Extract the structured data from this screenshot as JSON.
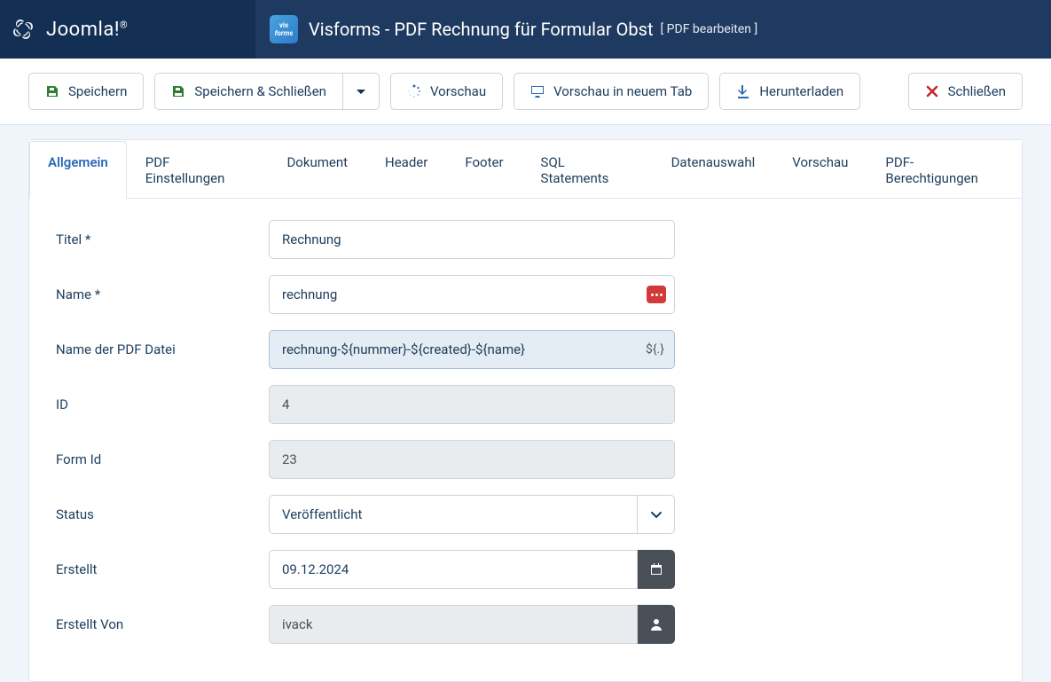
{
  "brand": "Joomla!",
  "appIconTop": "vis",
  "appIconBottom": "forms",
  "pageTitle": "Visforms - PDF Rechnung für Formular Obst",
  "pageSub": "[ PDF bearbeiten ]",
  "toolbar": {
    "save": "Speichern",
    "saveClose": "Speichern & Schließen",
    "preview": "Vorschau",
    "previewNewTab": "Vorschau in neuem Tab",
    "download": "Herunterladen",
    "close": "Schließen"
  },
  "tabs": [
    "Allgemein",
    "PDF Einstellungen",
    "Dokument",
    "Header",
    "Footer",
    "SQL Statements",
    "Datenauswahl",
    "Vorschau",
    "PDF-Berechtigungen"
  ],
  "form": {
    "titel_label": "Titel *",
    "titel_value": "Rechnung",
    "name_label": "Name *",
    "name_value": "rechnung",
    "pdfname_label": "Name der PDF Datei",
    "pdfname_value": "rechnung-${nummer}-${created}-${name}",
    "pdfname_hint": "${.}",
    "id_label": "ID",
    "id_value": "4",
    "formid_label": "Form Id",
    "formid_value": "23",
    "status_label": "Status",
    "status_value": "Veröffentlicht",
    "created_label": "Erstellt",
    "created_value": "09.12.2024",
    "createdby_label": "Erstellt Von",
    "createdby_value": "ivack"
  }
}
